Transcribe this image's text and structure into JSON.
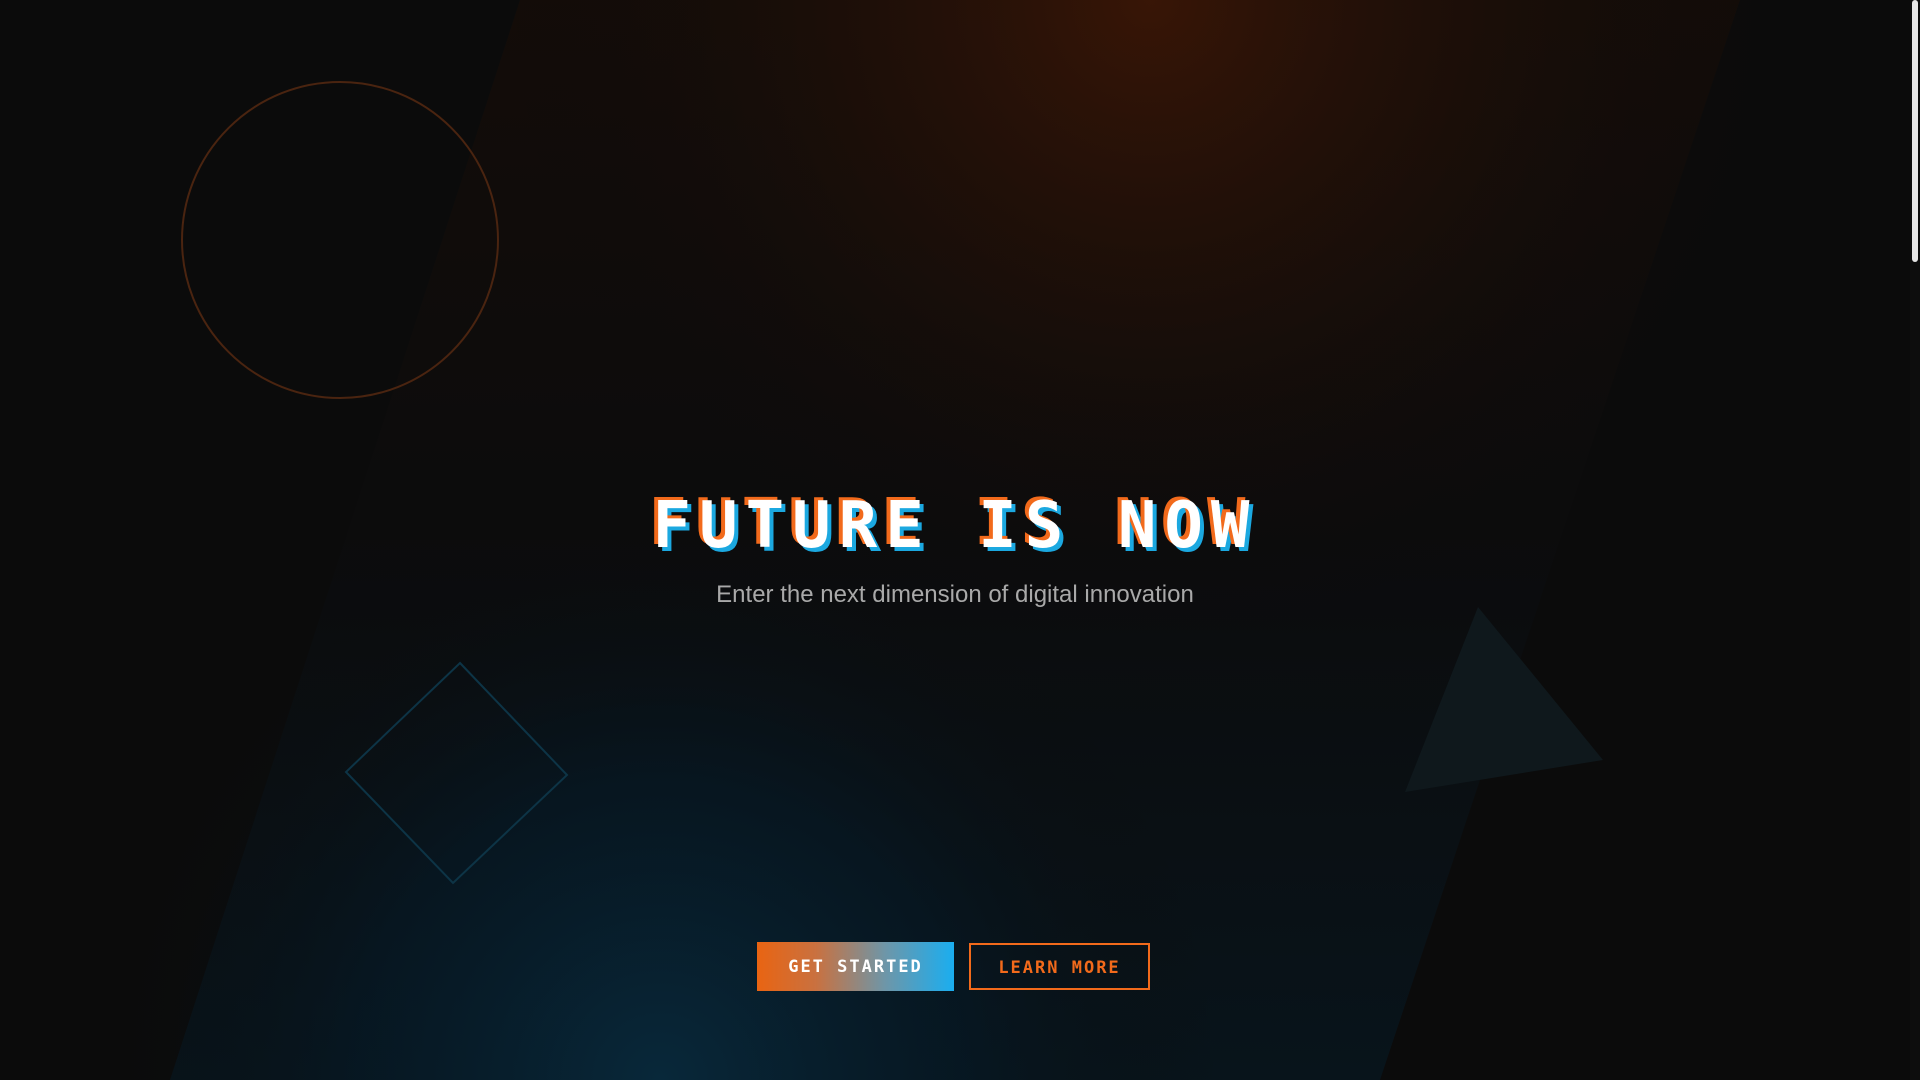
{
  "hero": {
    "title": "FUTURE IS NOW",
    "subtitle": "Enter the next dimension of digital innovation"
  },
  "buttons": {
    "primary_label": "GET STARTED",
    "secondary_label": "LEARN MORE"
  },
  "colors": {
    "background": "#0b0b0b",
    "accent_orange": "#f26a1b",
    "accent_blue": "#1ba8e0",
    "title_text": "#ffffff",
    "subtitle_text": "#a9a9a9"
  },
  "decorations": {
    "shapes": [
      "circle-outline",
      "diamond-outline",
      "triangle"
    ]
  }
}
